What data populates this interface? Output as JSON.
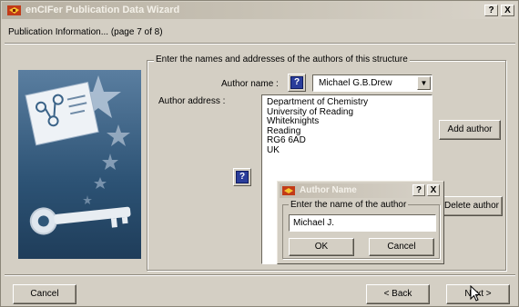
{
  "window": {
    "title": "enCIFer Publication Data Wizard",
    "help_label": "?",
    "close_label": "X",
    "subtitle": "Publication Information...  (page 7 of 8)"
  },
  "group": {
    "label": "Enter the names and addresses of the authors of this structure",
    "author_name_label": "Author name :",
    "author_name_value": "Michael G.B.Drew",
    "author_address_label": "Author address :",
    "help_icon": "?",
    "address_lines": [
      "Department of Chemistry",
      "University of Reading",
      "Whiteknights",
      "Reading",
      "RG6 6AD",
      "UK"
    ],
    "add_author": "Add author",
    "delete_author": "Delete author"
  },
  "dialog": {
    "title": "Author Name",
    "help_label": "?",
    "close_label": "X",
    "group_label": "Enter the name of the author",
    "input_value": "Michael J.",
    "ok": "OK",
    "cancel": "Cancel"
  },
  "footer": {
    "cancel": "Cancel",
    "back": "< Back",
    "next": "Next >"
  },
  "icons": {
    "app": "encifer-app-icon",
    "help": "question-mark-icon",
    "dropdown": "chevron-down-icon",
    "cursor": "mouse-pointer-icon"
  }
}
